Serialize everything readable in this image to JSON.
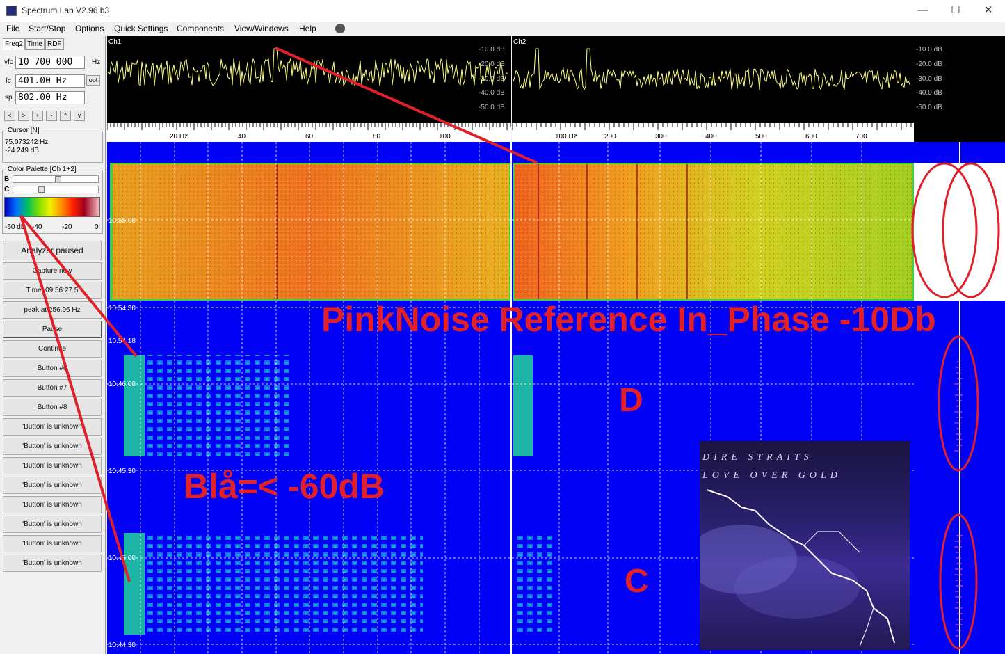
{
  "window": {
    "title": "Spectrum Lab V2.96 b3"
  },
  "window_controls": [
    "—",
    "☐",
    "✕"
  ],
  "menu": [
    "File",
    "Start/Stop",
    "Options",
    "Quick Settings",
    "Components",
    "View/Windows",
    "Help"
  ],
  "tabs": [
    "Freq2",
    "Time",
    "RDF"
  ],
  "freq": {
    "vfo_label": "vfo",
    "vfo_value": "10 700 000",
    "vfo_unit": "Hz",
    "fc_label": "fc",
    "fc_value": "401.00 Hz",
    "opt_label": "opt",
    "sp_label": "sp",
    "sp_value": "802.00 Hz",
    "nav_buttons": [
      "<",
      ">",
      "+",
      "-",
      "^",
      "v"
    ]
  },
  "cursor": {
    "title": "Cursor [N]",
    "freq": "75.073242 Hz",
    "level": "-24.249 dB"
  },
  "palette": {
    "title": "Color Palette [Ch 1+2]",
    "b_label": "B",
    "c_label": "C",
    "scale": [
      "-60 dB",
      "-40",
      "-20",
      "0"
    ]
  },
  "buttons": [
    "Analyzer paused",
    "Capture now",
    "Time: 09:56:27.5",
    "peak at 256.96 Hz",
    "Pause",
    "Continue",
    "Button #6",
    "Button #7",
    "Button #8",
    "'Button' is unknown",
    "'Button' is unknown",
    "'Button' is unknown",
    "'Button' is unknown",
    "'Button' is unknown",
    "'Button' is unknown",
    "'Button' is unknown",
    "'Button' is unknown"
  ],
  "spectrum": {
    "ch1": "Ch1",
    "ch2": "Ch2",
    "db_levels": [
      "-10.0 dB",
      "-20.0 dB",
      "-30.0 dB",
      "-40.0 dB",
      "-50.0 dB"
    ],
    "ch1_ticks": [
      "20 Hz",
      "40",
      "60",
      "80",
      "100"
    ],
    "ch2_ticks": [
      "100 Hz",
      "200",
      "300",
      "400",
      "500",
      "600",
      "700"
    ]
  },
  "waterfall": {
    "times": [
      "10.55.00",
      "10.54.30",
      "10.54.18",
      "10.46.00",
      "10.45.30",
      "10.45.00",
      "10.44.30"
    ]
  },
  "annotations": {
    "pink": "PinkNoise Reference In_Phase -10Db",
    "d": "D",
    "c": "C",
    "blue": "Blå=< -60dB"
  },
  "album": {
    "line1": "DIRE STRAITS",
    "line2": "LOVE OVER GOLD"
  },
  "colors": {
    "waterfall_bg": "#0000f4",
    "annotation_red": "#e0202a"
  }
}
